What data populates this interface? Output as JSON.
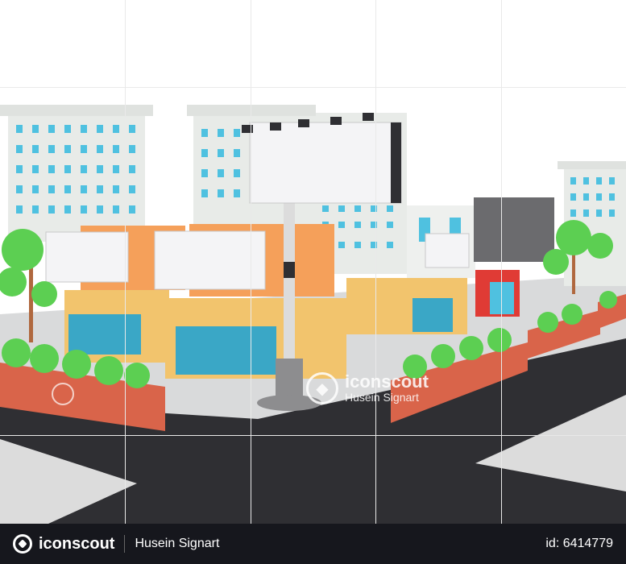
{
  "scene": {
    "colors": {
      "background": "#ffffff",
      "road": "#2f2f33",
      "sidewalk": "#d9dadb",
      "building": "#e8ebe8",
      "window": "#4fc1e0",
      "shop_wall": "#f2c46d",
      "shutter": "#3aa7c6",
      "planter": "#d9644a",
      "bush": "#5ccf52",
      "billboard": "#f4f4f6",
      "red_sign": "#e03b35"
    }
  },
  "watermark": {
    "brand": "iconscout",
    "author": "Husein Signart"
  },
  "footer": {
    "brand": "iconscout",
    "author": "Husein Signart",
    "asset_id": "id: 6414779"
  }
}
